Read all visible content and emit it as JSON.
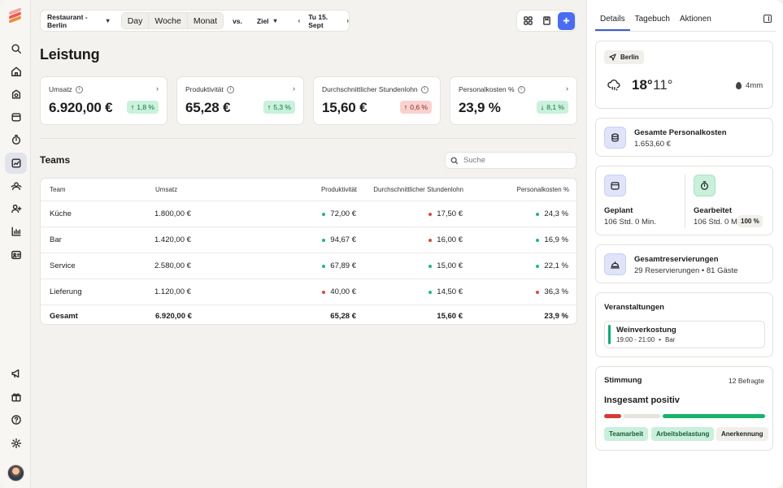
{
  "topbar": {
    "location": "Restaurant - Berlin",
    "periods": [
      "Day",
      "Woche",
      "Monat"
    ],
    "active_period": "Day",
    "vs": "vs.",
    "goal": "Ziel",
    "date": "Tu 15. Sept"
  },
  "page_title": "Leistung",
  "kpis": [
    {
      "label": "Umsatz",
      "value": "6.920,00 €",
      "change": "1,8 %",
      "trend": "up"
    },
    {
      "label": "Produktivität",
      "value": "65,28 €",
      "change": "5,3 %",
      "trend": "up"
    },
    {
      "label": "Durchschnittlicher Stundenlohn",
      "value": "15,60 €",
      "change": "0,6 %",
      "trend": "up-bad"
    },
    {
      "label": "Personalkosten %",
      "value": "23,9 %",
      "change": "8,1 %",
      "trend": "down"
    }
  ],
  "teams": {
    "title": "Teams",
    "search_placeholder": "Suche",
    "columns": [
      "Team",
      "Umsatz",
      "Produktivität",
      "Durchschnittlicher Stundenlohn",
      "Personalkosten %"
    ],
    "rows": [
      {
        "team": "Küche",
        "umsatz": "1.800,00 €",
        "prod": "72,00 €",
        "prod_status": "green",
        "lohn": "17,50 €",
        "lohn_status": "red",
        "pk": "24,3 %",
        "pk_status": "green"
      },
      {
        "team": "Bar",
        "umsatz": "1.420,00 €",
        "prod": "94,67 €",
        "prod_status": "green",
        "lohn": "16,00 €",
        "lohn_status": "red",
        "pk": "16,9 %",
        "pk_status": "green"
      },
      {
        "team": "Service",
        "umsatz": "2.580,00 €",
        "prod": "67,89 €",
        "prod_status": "green",
        "lohn": "15,00 €",
        "lohn_status": "green",
        "pk": "22,1 %",
        "pk_status": "green"
      },
      {
        "team": "Lieferung",
        "umsatz": "1.120,00 €",
        "prod": "40,00 €",
        "prod_status": "red",
        "lohn": "14,50 €",
        "lohn_status": "green",
        "pk": "36,3 %",
        "pk_status": "red"
      }
    ],
    "total": {
      "team": "Gesamt",
      "umsatz": "6.920,00 €",
      "prod": "65,28 €",
      "lohn": "15,60 €",
      "pk": "23,9 %"
    }
  },
  "panel": {
    "tabs": [
      "Details",
      "Tagebuch",
      "Aktionen"
    ],
    "active_tab": "Details",
    "weather": {
      "city": "Berlin",
      "high": "18°",
      "low": "11°",
      "rain": "4mm"
    },
    "personnel_cost": {
      "title": "Gesamte Personalkosten",
      "value": "1.653,60 €"
    },
    "planned": {
      "title": "Geplant",
      "value": "106 Std. 0 Min."
    },
    "worked": {
      "title": "Gearbeitet",
      "value": "106 Std. 0 Min.",
      "badge": "100 %"
    },
    "reservations": {
      "title": "Gesamtreservierungen",
      "value": "29 Reservierungen • 81 Gäste"
    },
    "events": {
      "title": "Veranstaltungen",
      "name": "Weinverkostung",
      "time": "19:00 - 21:00",
      "sep": "•",
      "place": "Bar"
    },
    "mood": {
      "title": "Stimmung",
      "count": "12 Befragte",
      "summary": "Insgesamt positiv",
      "tags": [
        "Teamarbeit",
        "Arbeitsbelastung",
        "Anerkennung"
      ]
    }
  },
  "colors": {
    "accent": "#4b6cf0",
    "positive": "#1fb87a",
    "negative": "#d64a3a"
  }
}
